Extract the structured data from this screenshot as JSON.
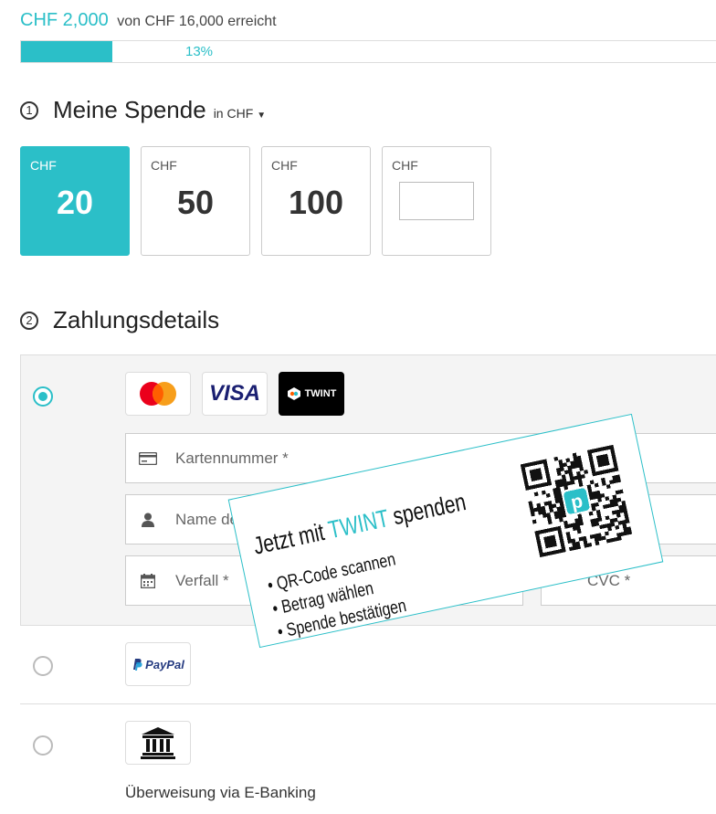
{
  "progress": {
    "raised": "CHF 2,000",
    "goal_text": "von CHF 16,000 erreicht",
    "percent_label": "13%",
    "fraction": 0.13
  },
  "step1": {
    "number": "1",
    "title": "Meine Spende",
    "currency_label": "in CHF"
  },
  "amounts": [
    {
      "currency": "CHF",
      "value": "20",
      "selected": true
    },
    {
      "currency": "CHF",
      "value": "50",
      "selected": false
    },
    {
      "currency": "CHF",
      "value": "100",
      "selected": false
    },
    {
      "currency": "CHF",
      "value": "",
      "custom": true
    }
  ],
  "step2": {
    "number": "2",
    "title": "Zahlungsdetails"
  },
  "card_logos": [
    "mastercard",
    "VISA",
    "TWINT"
  ],
  "fields": {
    "card_number": "Kartennummer *",
    "name": "Name de",
    "expiry": "Verfall *",
    "cvc": "CVC *"
  },
  "paypal": {
    "label": "PayPal"
  },
  "bank": {
    "label": "Überweisung via E-Banking"
  },
  "twint_promo": {
    "title_pre": "Jetzt mit",
    "title_brand": "TWINT",
    "title_post": "spenden",
    "steps": [
      "• QR-Code scannen",
      "• Betrag wählen",
      "• Spende bestätigen"
    ]
  },
  "colors": {
    "accent": "#2bbfc8",
    "visa": "#1a1f71",
    "paypal_dark": "#253b80",
    "paypal_light": "#179bd7"
  }
}
